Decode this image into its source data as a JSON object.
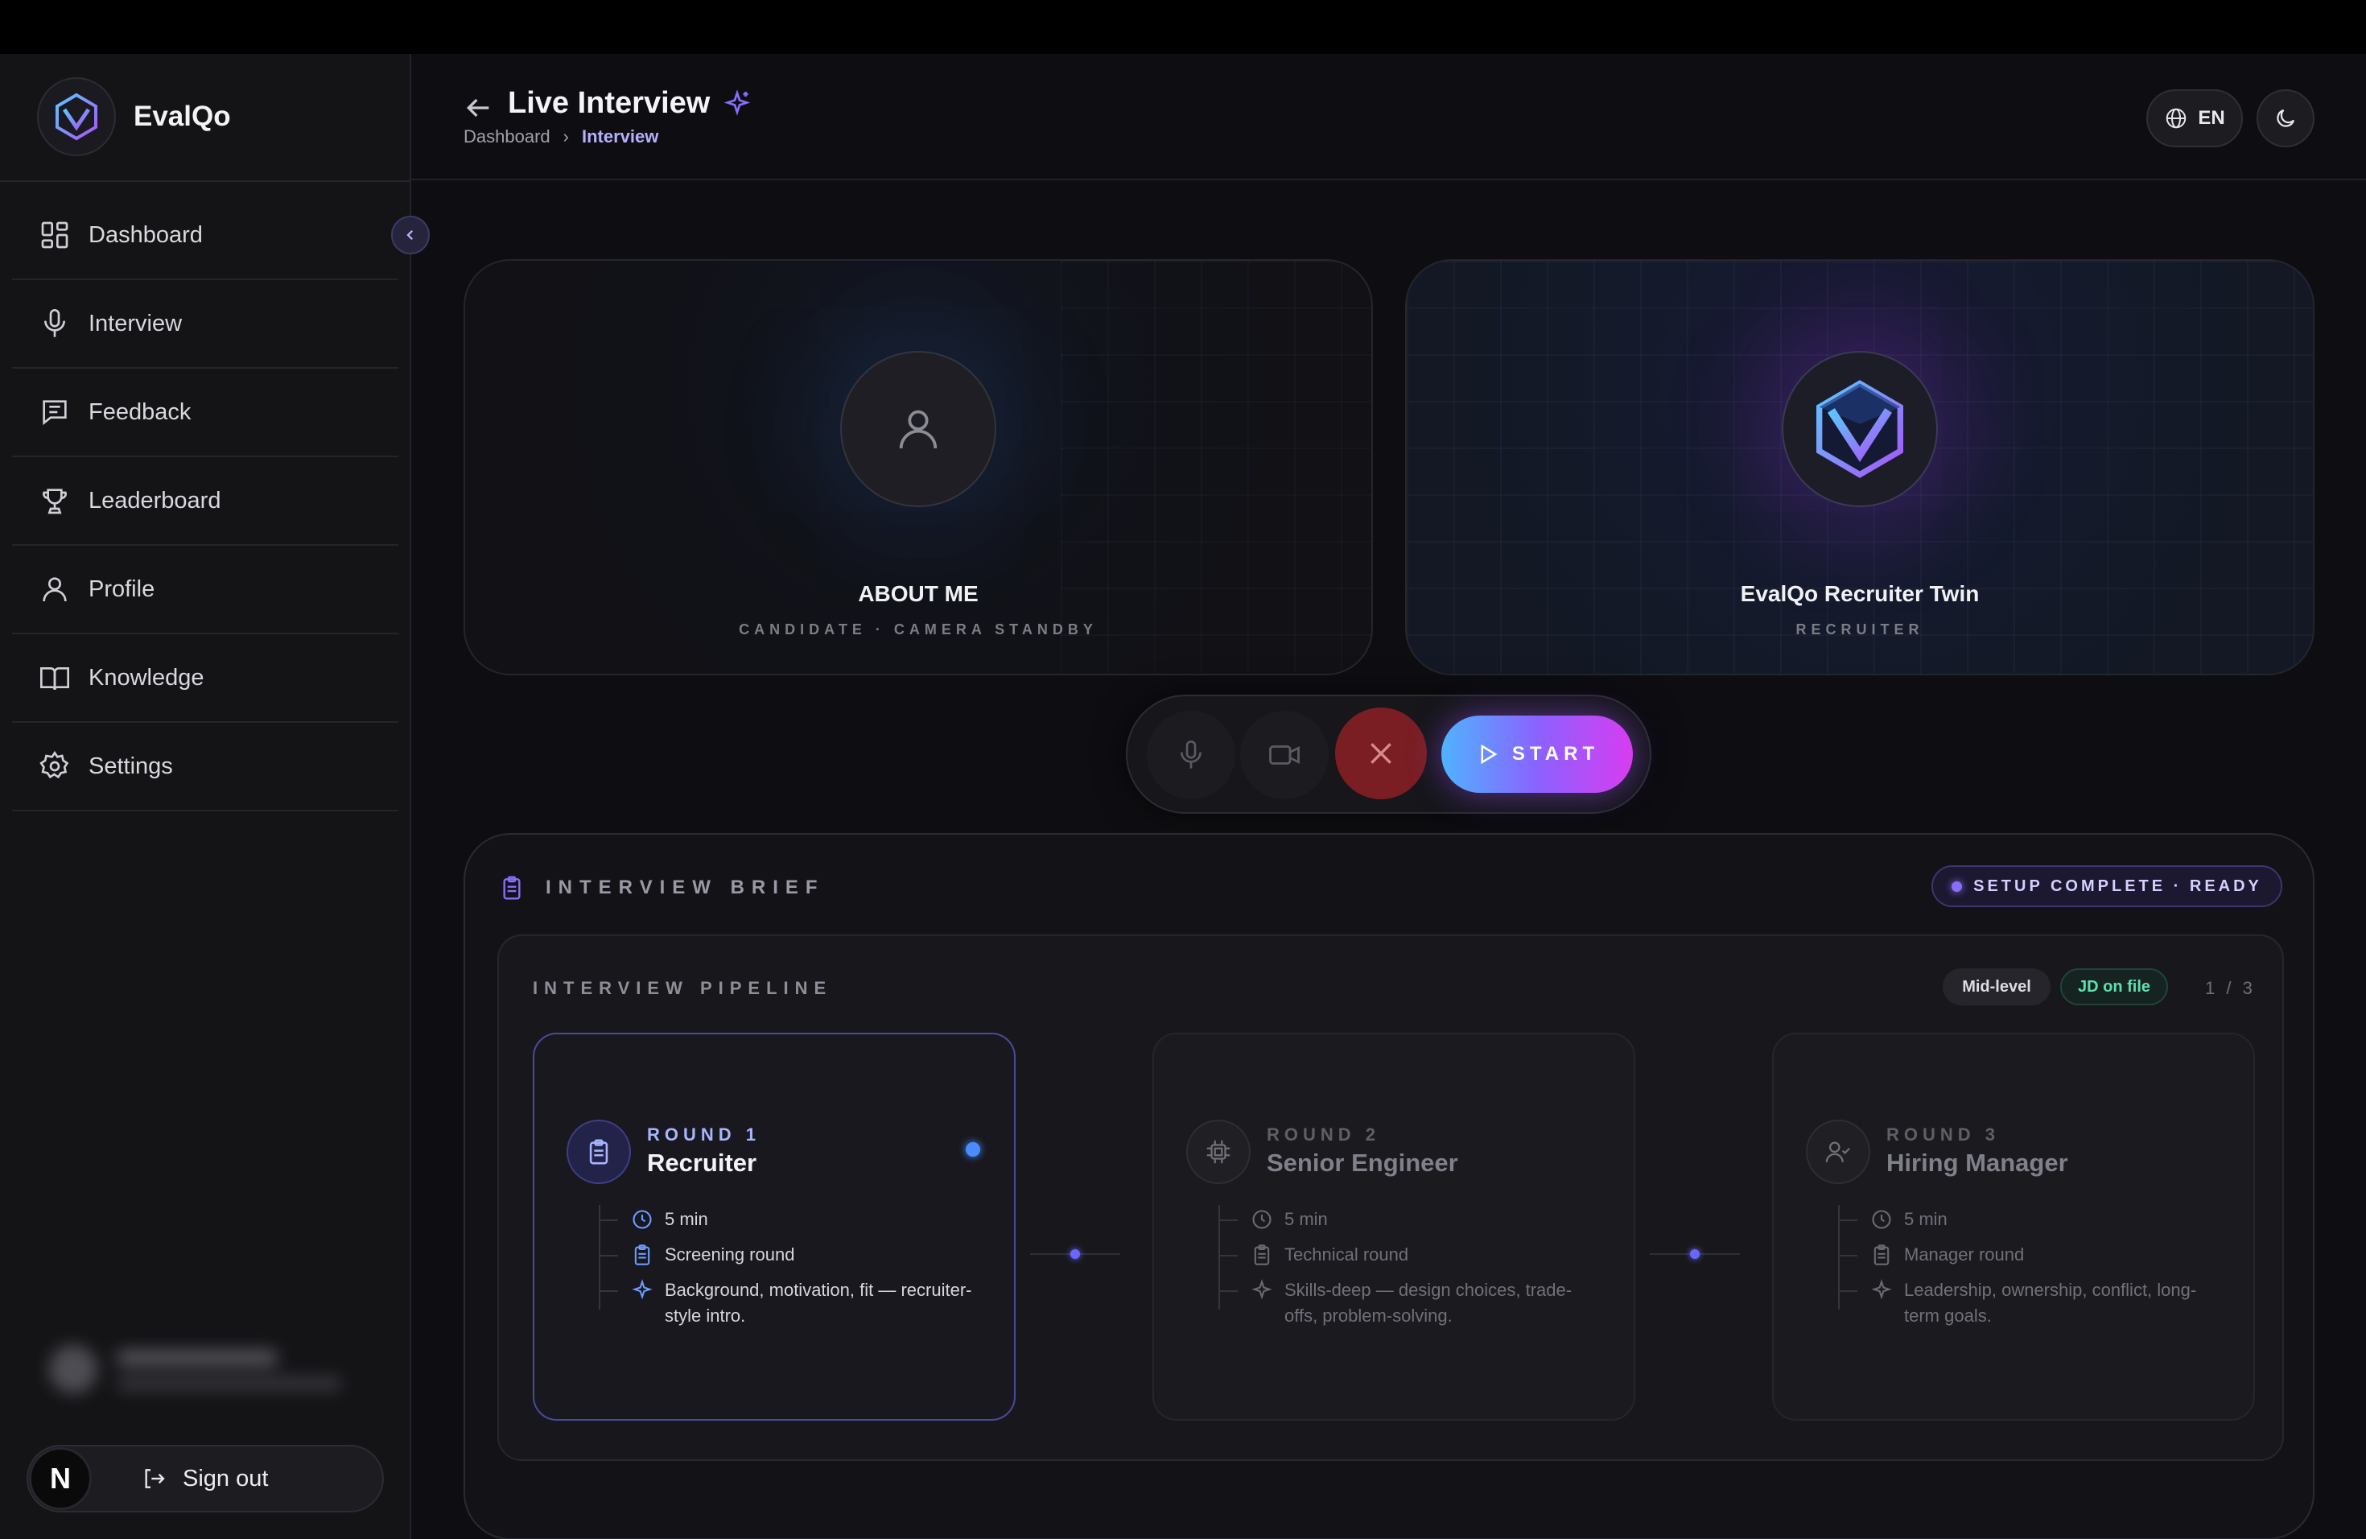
{
  "app": {
    "brand": "EvalQo"
  },
  "sidebar": {
    "items": [
      {
        "label": "Dashboard",
        "icon": "dashboard-icon"
      },
      {
        "label": "Interview",
        "icon": "mic-icon"
      },
      {
        "label": "Feedback",
        "icon": "message-icon"
      },
      {
        "label": "Leaderboard",
        "icon": "trophy-icon"
      },
      {
        "label": "Profile",
        "icon": "user-icon"
      },
      {
        "label": "Knowledge",
        "icon": "book-icon"
      },
      {
        "label": "Settings",
        "icon": "gear-icon"
      }
    ],
    "signout_label": "Sign out",
    "avatar_letter": "N"
  },
  "header": {
    "title": "Live Interview",
    "breadcrumb": [
      "Dashboard",
      "Interview"
    ],
    "language": "EN"
  },
  "tiles": {
    "candidate": {
      "name": "ABOUT ME",
      "subtitle": "CANDIDATE · CAMERA STANDBY"
    },
    "recruiter": {
      "name": "EvalQo Recruiter Twin",
      "subtitle": "RECRUITER"
    }
  },
  "controls": {
    "start_label": "START"
  },
  "brief": {
    "title": "INTERVIEW BRIEF",
    "status": "SETUP COMPLETE · READY",
    "pipeline": {
      "title": "INTERVIEW PIPELINE",
      "level": "Mid-level",
      "jd": "JD on file",
      "count": "1 / 3",
      "rounds": [
        {
          "label": "ROUND 1",
          "name": "Recruiter",
          "duration": "5 min",
          "type": "Screening round",
          "focus": "Background, motivation, fit — recruiter-style intro."
        },
        {
          "label": "ROUND 2",
          "name": "Senior Engineer",
          "duration": "5 min",
          "type": "Technical round",
          "focus": "Skills-deep — design choices, trade-offs, problem-solving."
        },
        {
          "label": "ROUND 3",
          "name": "Hiring Manager",
          "duration": "5 min",
          "type": "Manager round",
          "focus": "Leadership, ownership, conflict, long-term goals."
        }
      ]
    }
  },
  "colors": {
    "accent": "#8a6dff",
    "start_gradient": [
      "#4fb3ff",
      "#8a63ff",
      "#d83cf0"
    ],
    "end_call": "#7a1e23",
    "ready": "#5de0b0"
  }
}
